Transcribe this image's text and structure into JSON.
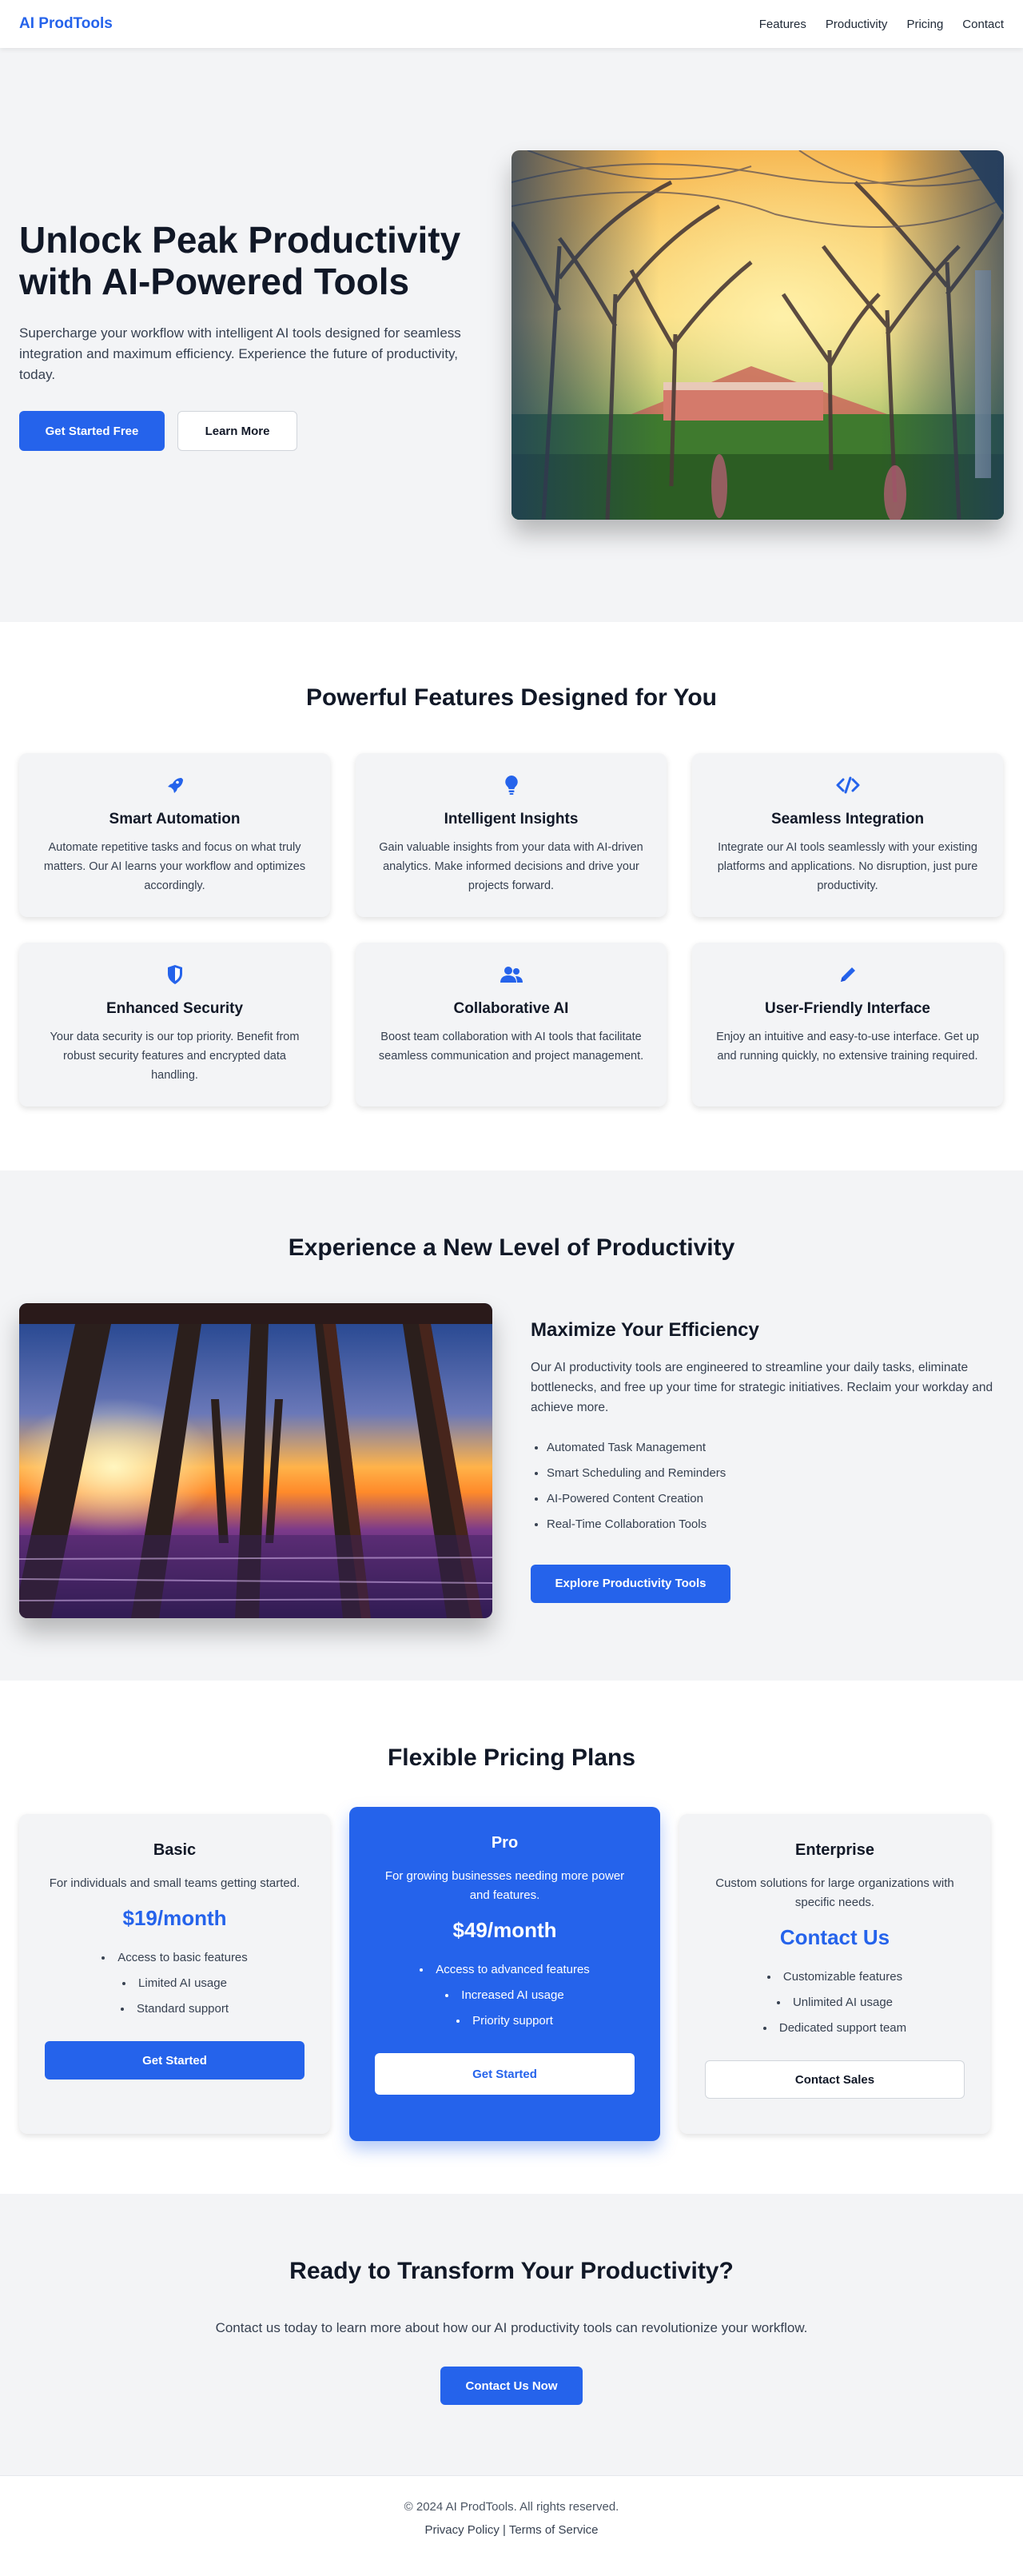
{
  "header": {
    "logo": "AI ProdTools",
    "nav": [
      "Features",
      "Productivity",
      "Pricing",
      "Contact"
    ]
  },
  "hero": {
    "title": "Unlock Peak Productivity with AI-Powered Tools",
    "subtitle": "Supercharge your workflow with intelligent AI tools designed for seamless integration and maximum efficiency. Experience the future of productivity, today.",
    "primary_button": "Get Started Free",
    "secondary_button": "Learn More"
  },
  "features": {
    "title": "Powerful Features Designed for You",
    "items": [
      {
        "icon": "rocket-icon",
        "title": "Smart Automation",
        "text": "Automate repetitive tasks and focus on what truly matters. Our AI learns your workflow and optimizes accordingly."
      },
      {
        "icon": "lightbulb-icon",
        "title": "Intelligent Insights",
        "text": "Gain valuable insights from your data with AI-driven analytics. Make informed decisions and drive your projects forward."
      },
      {
        "icon": "code-icon",
        "title": "Seamless Integration",
        "text": "Integrate our AI tools seamlessly with your existing platforms and applications. No disruption, just pure productivity."
      },
      {
        "icon": "shield-icon",
        "title": "Enhanced Security",
        "text": "Your data security is our top priority. Benefit from robust security features and encrypted data handling."
      },
      {
        "icon": "users-icon",
        "title": "Collaborative AI",
        "text": "Boost team collaboration with AI tools that facilitate seamless communication and project management."
      },
      {
        "icon": "pencil-icon",
        "title": "User-Friendly Interface",
        "text": "Enjoy an intuitive and easy-to-use interface. Get up and running quickly, no extensive training required."
      }
    ]
  },
  "experience": {
    "title": "Experience a New Level of Productivity",
    "heading": "Maximize Your Efficiency",
    "text": "Our AI productivity tools are engineered to streamline your daily tasks, eliminate bottlenecks, and free up your time for strategic initiatives. Reclaim your workday and achieve more.",
    "list": [
      "Automated Task Management",
      "Smart Scheduling and Reminders",
      "AI-Powered Content Creation",
      "Real-Time Collaboration Tools"
    ],
    "button": "Explore Productivity Tools"
  },
  "pricing": {
    "title": "Flexible Pricing Plans",
    "plans": [
      {
        "name": "Basic",
        "desc": "For individuals and small teams getting started.",
        "price": "$19/month",
        "features": [
          "Access to basic features",
          "Limited AI usage",
          "Standard support"
        ],
        "button": "Get Started"
      },
      {
        "name": "Pro",
        "desc": "For growing businesses needing more power and features.",
        "price": "$49/month",
        "features": [
          "Access to advanced features",
          "Increased AI usage",
          "Priority support"
        ],
        "button": "Get Started"
      },
      {
        "name": "Enterprise",
        "desc": "Custom solutions for large organizations with specific needs.",
        "price": "Contact Us",
        "features": [
          "Customizable features",
          "Unlimited AI usage",
          "Dedicated support team"
        ],
        "button": "Contact Sales"
      }
    ]
  },
  "cta": {
    "title": "Ready to Transform Your Productivity?",
    "text": "Contact us today to learn more about how our AI productivity tools can revolutionize your workflow.",
    "button": "Contact Us Now"
  },
  "footer": {
    "copyright": "© 2024 AI ProdTools. All rights reserved.",
    "privacy": "Privacy Policy",
    "separator": "|",
    "terms": "Terms of Service"
  },
  "colors": {
    "accent": "#2563eb",
    "section_bg": "#f3f4f6",
    "text_dark": "#111827"
  }
}
